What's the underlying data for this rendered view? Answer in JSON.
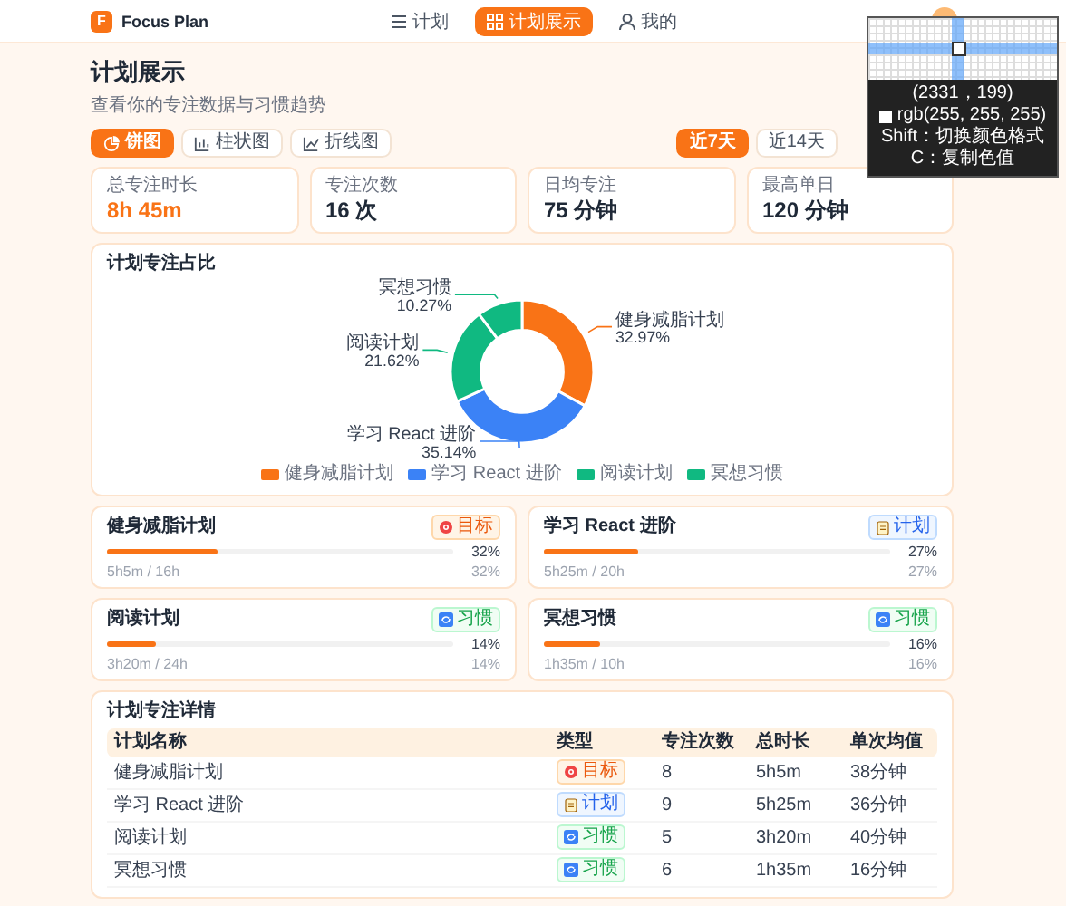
{
  "header": {
    "logo": "F",
    "app_name": "Focus Plan",
    "nav": [
      {
        "label": "计划",
        "selected": false
      },
      {
        "label": "计划展示",
        "selected": true
      },
      {
        "label": "我的",
        "selected": false
      }
    ]
  },
  "page": {
    "title": "计划展示",
    "subtitle": "查看你的专注数据与习惯趋势"
  },
  "chart_tabs": [
    {
      "label": "饼图",
      "selected": true
    },
    {
      "label": "柱状图",
      "selected": false
    },
    {
      "label": "折线图",
      "selected": false
    }
  ],
  "ranges": [
    {
      "label": "近7天",
      "selected": true
    },
    {
      "label": "近14天",
      "selected": false
    }
  ],
  "stats": [
    {
      "label": "总专注时长",
      "value": "8h 45m",
      "accent": true
    },
    {
      "label": "专注次数",
      "value": "16 次",
      "accent": false
    },
    {
      "label": "日均专注",
      "value": "75 分钟",
      "accent": false
    },
    {
      "label": "最高单日",
      "value": "120 分钟",
      "accent": false
    }
  ],
  "chart_card": {
    "title": "计划专注占比",
    "chart_data": {
      "type": "donut",
      "categories": [
        "健身减脂计划",
        "学习 React 进阶",
        "阅读计划",
        "冥想习惯"
      ],
      "values": [
        32.97,
        35.14,
        21.62,
        10.27
      ],
      "value_labels": [
        "32.97%",
        "35.14%",
        "21.62%",
        "10.27%"
      ]
    },
    "legend": [
      {
        "label": "健身减脂计划",
        "color": "#f97316"
      },
      {
        "label": "学习 React 进阶",
        "color": "#3b82f6"
      },
      {
        "label": "阅读计划",
        "color": "#10b981"
      },
      {
        "label": "冥想习惯",
        "color": "#10b981"
      }
    ]
  },
  "progress_cards": [
    {
      "name": "健身减脂计划",
      "kind": "goal",
      "type": "目标",
      "level": 0.32,
      "percent": "32%",
      "detail": "5h5m / 16h",
      "percent_2": "32%"
    },
    {
      "name": "学习 React 进阶",
      "kind": "plan",
      "type": "计划",
      "level": 0.27,
      "percent": "27%",
      "detail": "5h25m / 20h",
      "percent_2": "27%"
    },
    {
      "name": "阅读计划",
      "kind": "habit",
      "type": "习惯",
      "level": 0.14,
      "percent": "14%",
      "detail": "3h20m / 24h",
      "percent_2": "14%"
    },
    {
      "name": "冥想习惯",
      "kind": "habit",
      "type": "习惯",
      "level": 0.16,
      "percent": "16%",
      "detail": "1h35m / 10h",
      "percent_2": "16%"
    }
  ],
  "table": {
    "title": "计划专注详情",
    "columns": [
      "计划名称",
      "类型",
      "专注次数",
      "总时长",
      "单次均值"
    ],
    "rows": [
      {
        "name": "健身减脂计划",
        "kind": "goal",
        "type": "目标",
        "count": "8",
        "total": "5h5m",
        "average": "38分钟"
      },
      {
        "name": "学习 React 进阶",
        "kind": "plan",
        "type": "计划",
        "count": "9",
        "total": "5h25m",
        "average": "36分钟"
      },
      {
        "name": "阅读计划",
        "kind": "habit",
        "type": "习惯",
        "count": "5",
        "total": "3h20m",
        "average": "40分钟"
      },
      {
        "name": "冥想习惯",
        "kind": "habit",
        "type": "习惯",
        "count": "6",
        "total": "1h35m",
        "average": "16分钟"
      }
    ]
  },
  "color_picker": {
    "coordinates": "(2331，199)",
    "color_value": "rgb(255, 255, 255)",
    "hint_1": "Shift：切换颜色格式",
    "hint_2": "C：复制色值"
  }
}
